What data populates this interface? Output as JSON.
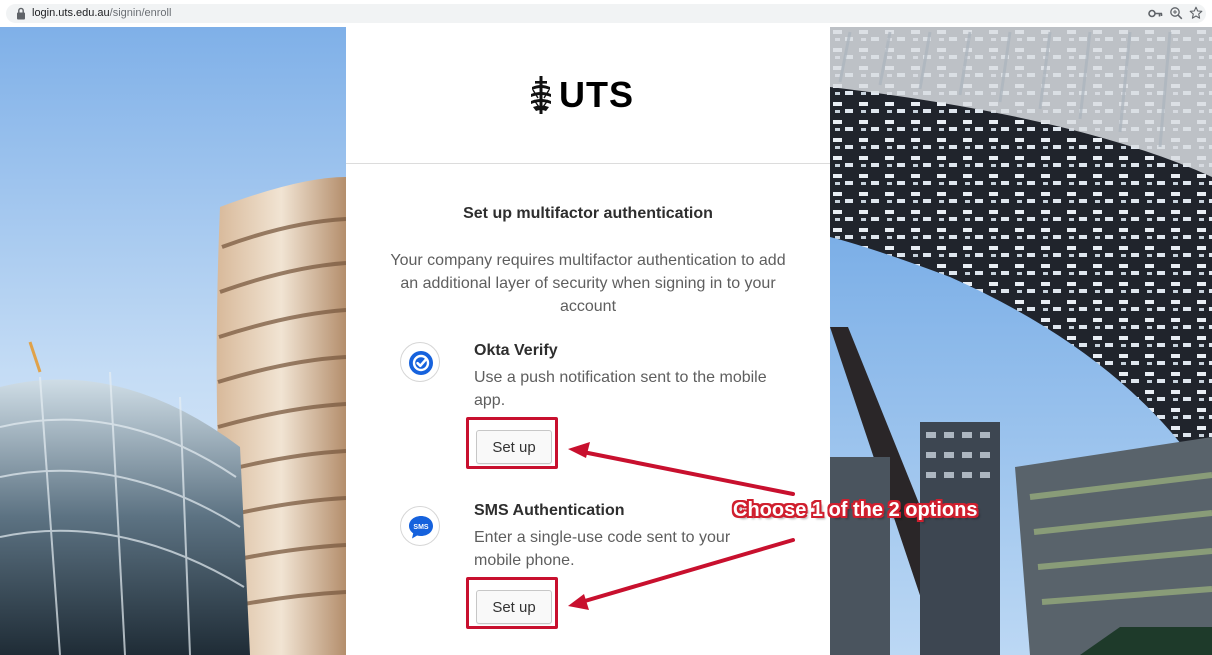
{
  "browser": {
    "url_host": "login.uts.edu.au",
    "url_path": "/signin/enroll",
    "icons": [
      "lock-icon",
      "key-icon",
      "zoom-icon",
      "star-icon"
    ]
  },
  "brand": {
    "logo_text": "UTS",
    "logo_icon": "uts-crest-icon"
  },
  "page": {
    "title": "Set up multifactor authentication",
    "description": "Your company requires multifactor authentication to add an additional layer of security when signing in to your account"
  },
  "factors": [
    {
      "name": "Okta Verify",
      "description": "Use a push notification sent to the mobile app.",
      "button": "Set up",
      "icon": "okta-verify-icon"
    },
    {
      "name": "SMS Authentication",
      "description": "Enter a single-use code sent to your mobile phone.",
      "button": "Set up",
      "icon": "sms-icon",
      "icon_text": "SMS"
    }
  ],
  "annotation": {
    "callout": "Choose 1 of the 2 options",
    "color": "#c8102e"
  },
  "colors": {
    "okta_blue": "#1662dd",
    "highlight_red": "#c8102e",
    "sky": "#9ec5ee"
  }
}
